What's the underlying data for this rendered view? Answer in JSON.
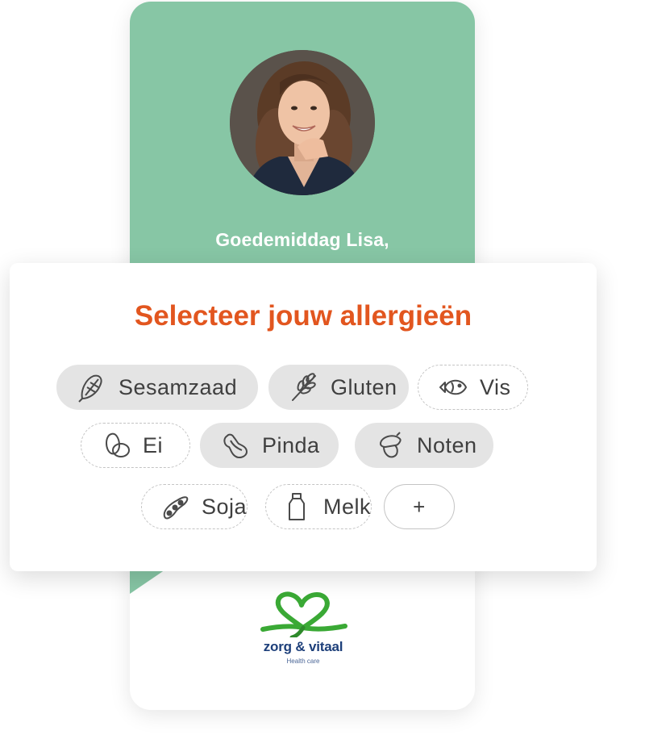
{
  "profile": {
    "greeting": "Goedemiddag Lisa,"
  },
  "allergy_card": {
    "title": "Selecteer jouw allergieën",
    "chips": [
      {
        "label": "Sesamzaad",
        "icon": "corn-icon",
        "selected": true
      },
      {
        "label": "Gluten",
        "icon": "wheat-icon",
        "selected": true
      },
      {
        "label": "Vis",
        "icon": "fish-icon",
        "selected": false
      },
      {
        "label": "Ei",
        "icon": "egg-icon",
        "selected": false
      },
      {
        "label": "Pinda",
        "icon": "peanut-icon",
        "selected": true
      },
      {
        "label": "Noten",
        "icon": "acorn-icon",
        "selected": true
      },
      {
        "label": "Soja",
        "icon": "soybean-icon",
        "selected": false
      },
      {
        "label": "Melk",
        "icon": "milk-bottle-icon",
        "selected": false
      }
    ],
    "add_label": "+"
  },
  "brand": {
    "name": "zorg & vitaal",
    "tagline": "Health care",
    "colors": {
      "green": "#3aa935",
      "navy": "#1d3f7a",
      "header_green": "#87c6a5",
      "accent_orange": "#e2561f"
    }
  }
}
